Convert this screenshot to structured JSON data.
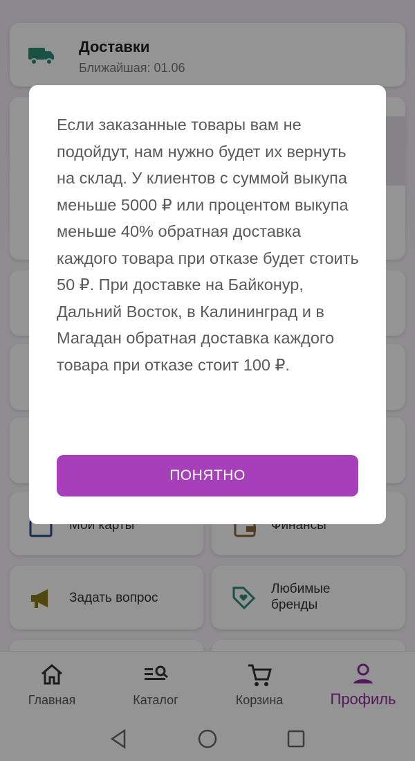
{
  "delivery_card": {
    "title": "Доставки",
    "subtitle": "Ближайшая: 01.06"
  },
  "tiles": {
    "my_cards": "Мои карты",
    "finances": "Финансы",
    "ask_question": "Задать вопрос",
    "favorite_brands": "Любимые бренды"
  },
  "dialog": {
    "message": "Если заказанные товары вам не подойдут, нам нужно будет их вернуть на склад.  У клиентов с суммой выкупа меньше 5000 ₽ или процентом выкупа меньше 40% обратная доставка каждого товара при отказе будет стоить 50 ₽.  При доставке на Байконур, Дальний Восток, в Калининград и в Магадан обратная доставка каждого товара при отказе стоит 100 ₽.",
    "button": "ПОНЯТНО"
  },
  "bottom_nav": [
    {
      "label": "Главная",
      "icon": "home-icon"
    },
    {
      "label": "Каталог",
      "icon": "catalog-search-icon"
    },
    {
      "label": "Корзина",
      "icon": "cart-icon"
    },
    {
      "label": "Профиль",
      "icon": "profile-icon",
      "active": true
    }
  ],
  "system_nav": [
    "back-icon",
    "home-circle-icon",
    "recents-icon"
  ],
  "colors": {
    "accent": "#a73fbb",
    "active_nav": "#8e2b9e",
    "delivery_icon": "#2e7d6f"
  }
}
